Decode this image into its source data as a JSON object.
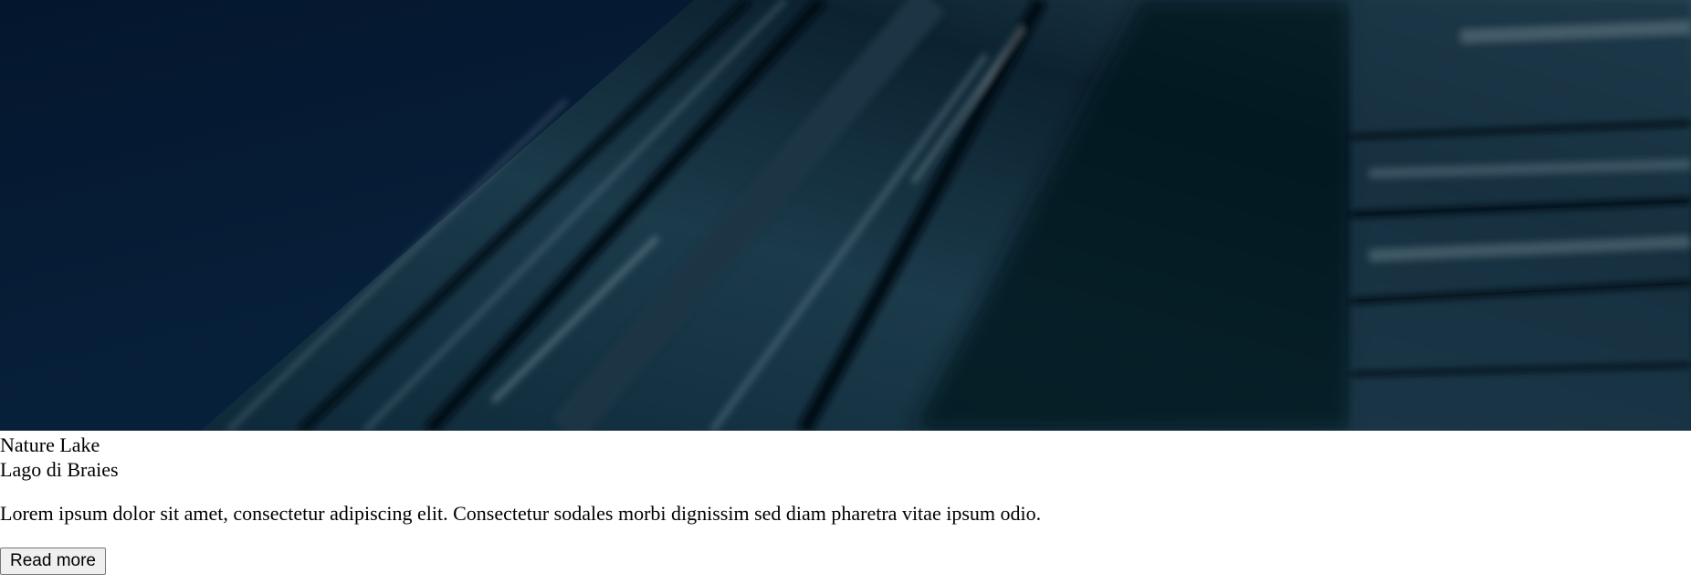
{
  "hero": {
    "image_alt": "Dark blue textured close-up",
    "colors": {
      "base": "#061a33",
      "stroke_dark": "#020a12",
      "stroke_mid": "#1d3a4a",
      "highlight": "#6f8a99"
    }
  },
  "card": {
    "eyebrow": "Nature Lake",
    "title": "Lago di Braies",
    "description": "Lorem ipsum dolor sit amet, consectetur adipiscing elit. Consectetur sodales morbi dignissim sed diam pharetra vitae ipsum odio.",
    "button_label": "Read more"
  }
}
